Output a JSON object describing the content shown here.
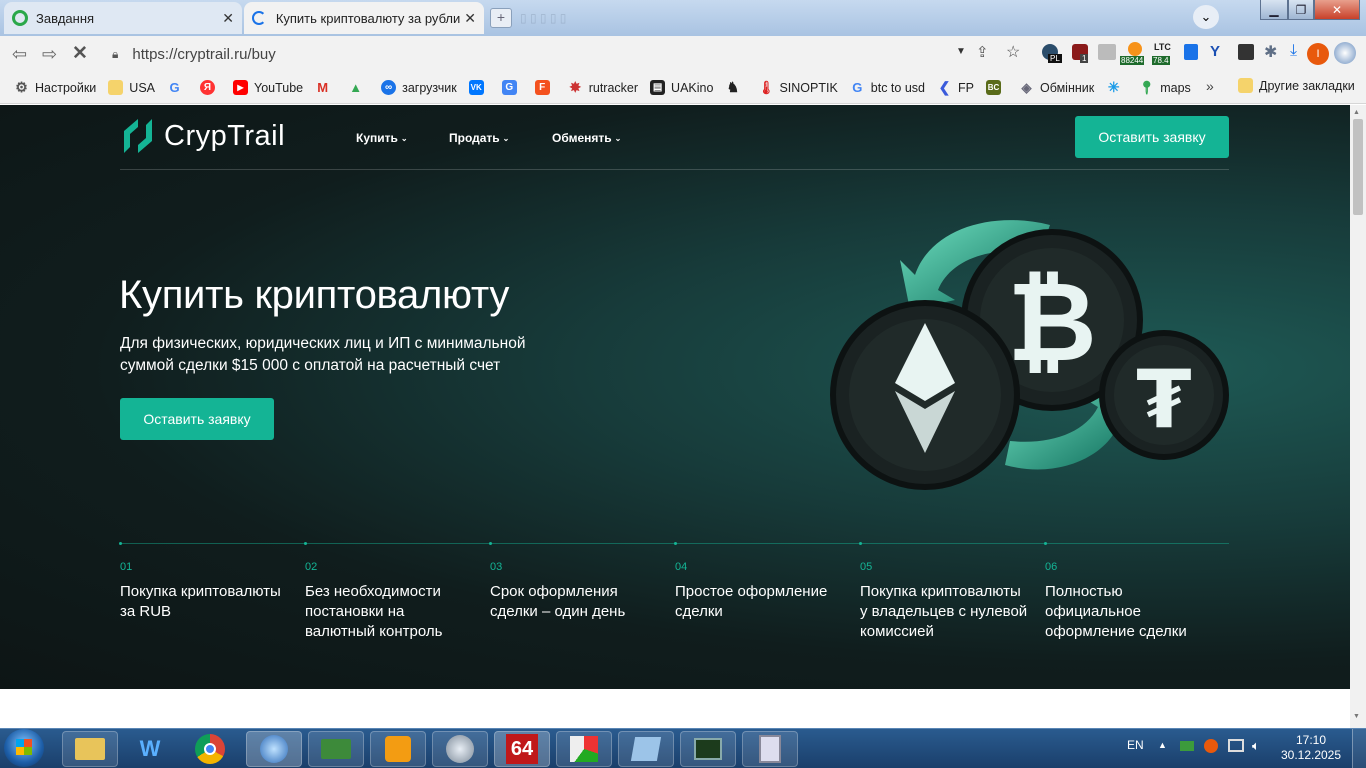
{
  "browser": {
    "tabs": [
      {
        "title": "Завдання",
        "state": "inactive"
      },
      {
        "title": "Купить криптовалюту за рубли (R",
        "state": "active"
      }
    ],
    "url": "https://cryptrail.ru/buy",
    "bookmarks": [
      {
        "label": "Настройки",
        "icon": "gear-icon"
      },
      {
        "label": "USA",
        "icon": "folder-icon"
      },
      {
        "label": "",
        "icon": "google-icon"
      },
      {
        "label": "",
        "icon": "yandex-icon"
      },
      {
        "label": "YouTube",
        "icon": "youtube-icon"
      },
      {
        "label": "",
        "icon": "gmail-icon"
      },
      {
        "label": "",
        "icon": "drive-icon"
      },
      {
        "label": "загрузчик",
        "icon": "link-icon"
      },
      {
        "label": "",
        "icon": "vk-icon"
      },
      {
        "label": "",
        "icon": "translate-icon"
      },
      {
        "label": "",
        "icon": "f-icon"
      },
      {
        "label": "rutracker",
        "icon": "rutracker-icon"
      },
      {
        "label": "UAKino",
        "icon": "uakino-icon"
      },
      {
        "label": "",
        "icon": "chess-icon"
      },
      {
        "label": "SINOPTIK",
        "icon": "thermometer-icon"
      },
      {
        "label": "btc to usd",
        "icon": "google-icon"
      },
      {
        "label": "FP",
        "icon": "fp-icon"
      },
      {
        "label": "",
        "icon": "bc-icon"
      },
      {
        "label": "Обмінник",
        "icon": "exchange-icon"
      },
      {
        "label": "",
        "icon": "star-icon"
      },
      {
        "label": "maps",
        "icon": "maps-icon"
      }
    ],
    "more_bookmarks": "»",
    "other_bookmarks": "Другие закладки",
    "extension_badges": {
      "pl": "PL",
      "one": "1",
      "btc": "88244",
      "ltc_label": "LTC",
      "ltc": "78.4"
    },
    "avatar_letter": "I"
  },
  "site": {
    "logo": "CrypTrail",
    "nav": [
      "Купить",
      "Продать",
      "Обменять"
    ],
    "cta": "Оставить заявку",
    "hero_title": "Купить криптовалюту",
    "hero_subtitle_1": "Для физических, юридических лиц и ИП с минимальной",
    "hero_subtitle_2": "суммой сделки $15 000 с оплатой на расчетный счет",
    "hero_cta": "Оставить заявку",
    "features": [
      {
        "num": "01",
        "text": "Покупка криптовалюты за RUB"
      },
      {
        "num": "02",
        "text": "Без необходимости постановки на валютный контроль"
      },
      {
        "num": "03",
        "text": "Срок оформления сделки – один день"
      },
      {
        "num": "04",
        "text": "Простое оформление сделки"
      },
      {
        "num": "05",
        "text": "Покупка криптовалюты у владельцев с нулевой комиссией"
      },
      {
        "num": "06",
        "text": "Полностью официальное оформление сделки"
      }
    ]
  },
  "taskbar": {
    "lang": "EN",
    "time": "17:10",
    "date": "30.12.2025",
    "apps": [
      "explorer-icon",
      "wise-icon",
      "chrome-icon",
      "globe-icon",
      "gpu-icon",
      "media-icon",
      "clock-icon",
      "aida64-icon",
      "chart-app-icon",
      "notes-icon",
      "monitor-icon",
      "calculator-icon"
    ],
    "aida_label": "64"
  }
}
